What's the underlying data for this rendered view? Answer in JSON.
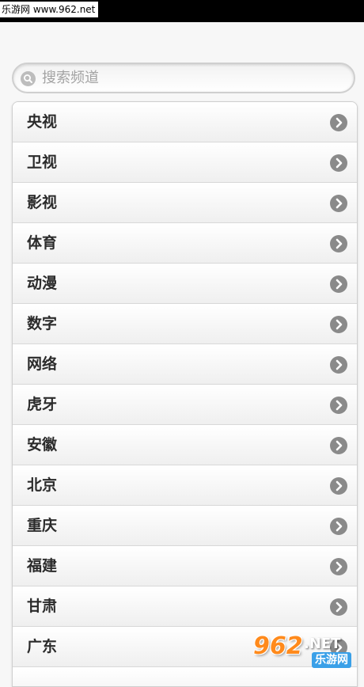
{
  "watermark_top": "乐游网 www.962.net",
  "search": {
    "placeholder": "搜索频道",
    "icon": "search-icon"
  },
  "channels": [
    {
      "label": "央视"
    },
    {
      "label": "卫视"
    },
    {
      "label": "影视"
    },
    {
      "label": "体育"
    },
    {
      "label": "动漫"
    },
    {
      "label": "数字"
    },
    {
      "label": "网络"
    },
    {
      "label": "虎牙"
    },
    {
      "label": "安徽"
    },
    {
      "label": "北京"
    },
    {
      "label": "重庆"
    },
    {
      "label": "福建"
    },
    {
      "label": "甘肃"
    },
    {
      "label": "广东"
    },
    {
      "label": ""
    }
  ],
  "watermark_logo": {
    "main": "962",
    "suffix": ".NET",
    "sub": "乐游网"
  },
  "colors": {
    "arrow": "#8a8a8a",
    "label": "#2b2b2b",
    "logo_orange": "#ff8a1c",
    "logo_blue": "#3aa0e8"
  }
}
